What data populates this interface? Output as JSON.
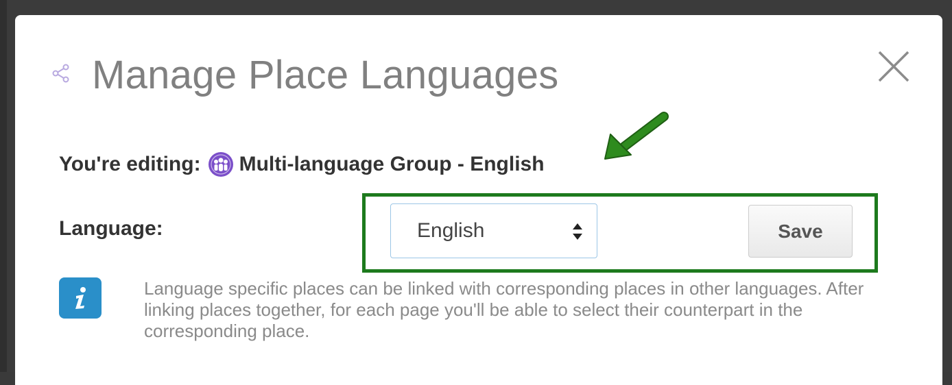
{
  "dialog": {
    "title": "Manage Place Languages"
  },
  "editing": {
    "prefix": "You're editing:",
    "place_name": "Multi-language Group - English"
  },
  "language_form": {
    "label": "Language:",
    "selected_language": "English",
    "save_label": "Save"
  },
  "info": {
    "text": "Language specific places can be linked with corresponding places in other languages. After linking places together, for each page you'll be able to select their counterpart in the corresponding place."
  },
  "icons": {
    "title_icon": "share-icon",
    "close": "close-icon",
    "place_icon": "group-icon",
    "info": "info-icon",
    "annotation_arrow": "arrow-icon"
  },
  "colors": {
    "highlight": "#1d7a1d",
    "arrow": "#2e8b1e",
    "place_icon": "#7b4fc9",
    "info_icon": "#2a8fc9",
    "title_text": "#808080"
  }
}
